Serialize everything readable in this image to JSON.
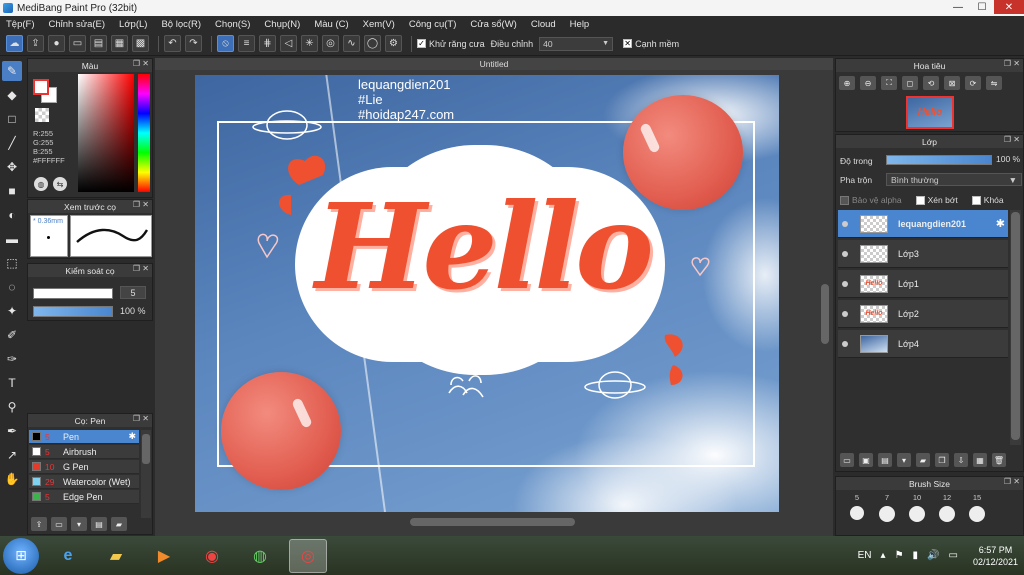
{
  "window": {
    "title": "MediBang Paint Pro (32bit)",
    "minimize": "—",
    "maximize": "☐",
    "close": "✕"
  },
  "menu": [
    "Tệp(F)",
    "Chỉnh sửa(E)",
    "Lớp(L)",
    "Bộ lọc(R)",
    "Chọn(S)",
    "Chụp(N)",
    "Màu (C)",
    "Xem(V)",
    "Công cụ(T)",
    "Cửa sổ(W)",
    "Cloud",
    "Help"
  ],
  "toolbar": {
    "antialias_label": "Khử răng cưa",
    "correction_label": "Điều chỉnh",
    "correction_value": "40",
    "sharp_label": "Cạnh mềm"
  },
  "color_panel": {
    "title": "Màu",
    "r": "R:255",
    "g": "G:255",
    "b": "B:255",
    "hex": "#FFFFFF"
  },
  "preview_panel": {
    "title": "Xem trước cọ",
    "size": "0.36mm"
  },
  "brush_control": {
    "title": "Kiểm soát cọ",
    "size_value": "5",
    "opacity_value": "100 %",
    "size_level": 1.0,
    "opacity_level": 1.0
  },
  "brush_panel": {
    "title": "Cọ: Pen",
    "brushes": [
      {
        "size": "5",
        "name": "Pen",
        "color": "#000000"
      },
      {
        "size": "5",
        "name": "Airbrush",
        "color": "#ffffff"
      },
      {
        "size": "10",
        "name": "G Pen",
        "color": "#e33a2a"
      },
      {
        "size": "29",
        "name": "Watercolor (Wet)",
        "color": "#7fd3f0"
      },
      {
        "size": "5",
        "name": "Edge Pen",
        "color": "#3ab54a"
      }
    ]
  },
  "canvas": {
    "tab_title": "Untitled",
    "watermark": [
      "lequangdien201",
      "#Lie",
      "#hoidap247.com"
    ],
    "artwork_text": "Hello"
  },
  "navigator": {
    "title": "Hoa tiêu"
  },
  "layer_panel": {
    "title": "Lớp",
    "opacity_label": "Độ trong",
    "opacity_value": "100 %",
    "opacity_level": 1.0,
    "blend_label": "Pha trộn",
    "blend_value": "Bình thường",
    "protect_alpha": "Bảo vệ alpha",
    "clipping": "Xén bớt",
    "lock": "Khóa",
    "layers": [
      "lequangdien201",
      "Lớp3",
      "Lớp1",
      "Lớp2",
      "Lớp4"
    ]
  },
  "brush_size_panel": {
    "title": "Brush Size",
    "sizes": [
      "5",
      "7",
      "10",
      "12",
      "15"
    ]
  },
  "taskbar": {
    "lang": "EN",
    "time": "6:57 PM",
    "date": "02/12/2021"
  }
}
